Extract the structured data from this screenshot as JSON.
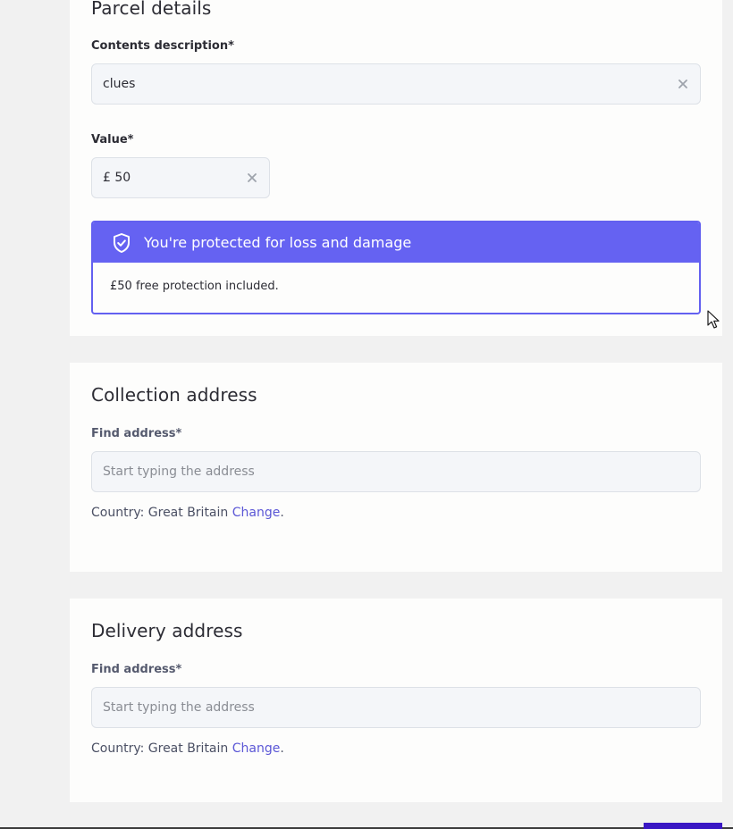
{
  "parcel": {
    "title": "Parcel details",
    "contents_label": "Contents description*",
    "contents_value": "clues",
    "value_label": "Value*",
    "value_value": "£ 50",
    "protection": {
      "heading": "You're protected for loss and damage",
      "body": "£50 free protection included."
    }
  },
  "collection": {
    "title": "Collection address",
    "find_label": "Find address*",
    "find_placeholder": "Start typing the address",
    "country_prefix": "Country: Great Britain",
    "change_link": "Change",
    "suffix": "."
  },
  "delivery": {
    "title": "Delivery address",
    "find_label": "Find address*",
    "find_placeholder": "Start typing the address",
    "country_prefix": "Country: Great Britain",
    "change_link": "Change",
    "suffix": "."
  },
  "icons": {
    "clear": "close-icon",
    "shield": "shield-check-icon",
    "cursor": "mouse-pointer-icon"
  },
  "colors": {
    "accent": "#6562f2",
    "link": "#5b57d6",
    "primary_button": "#3a17c4"
  }
}
